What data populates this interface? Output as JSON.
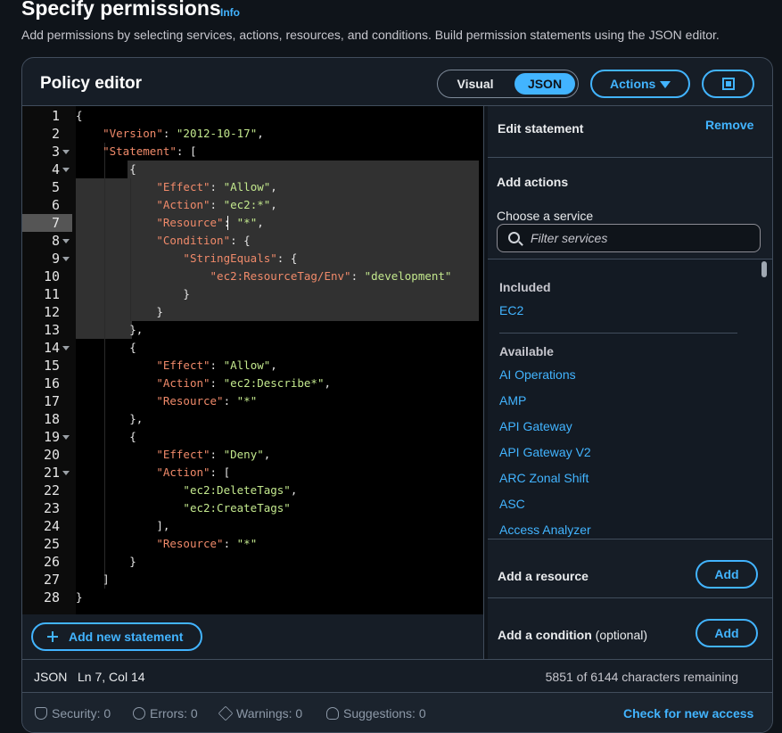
{
  "header": {
    "title": "Specify permissions",
    "info": "Info",
    "subtitle": "Add permissions by selecting services, actions, resources, and conditions. Build permission statements using the JSON editor."
  },
  "editor_panel": {
    "title": "Policy editor",
    "mode_visual": "Visual",
    "mode_json": "JSON",
    "actions_label": "Actions",
    "add_statement_label": "Add new statement"
  },
  "code": {
    "line_numbers": [
      "1",
      "2",
      "3",
      "4",
      "5",
      "6",
      "7",
      "8",
      "9",
      "10",
      "11",
      "12",
      "13",
      "14",
      "15",
      "16",
      "17",
      "18",
      "19",
      "20",
      "21",
      "22",
      "23",
      "24",
      "25",
      "26",
      "27",
      "28"
    ],
    "cursor_line": 7,
    "tokens": {
      "l1": "{",
      "l2_key": "\"Version\"",
      "l2_val": "\"2012-10-17\"",
      "l3_key": "\"Statement\"",
      "l3_rest": ": [",
      "l4": "{",
      "l5_key": "\"Effect\"",
      "l5_val": "\"Allow\"",
      "l6_key": "\"Action\"",
      "l6_val": "\"ec2:*\"",
      "l7_key": "\"Resource\"",
      "l7_val": "\"*\"",
      "l8_key": "\"Condition\"",
      "l8_rest": ": {",
      "l9_key": "\"StringEquals\"",
      "l9_rest": ": {",
      "l10_key": "\"ec2:ResourceTag/Env\"",
      "l10_val": "\"development\"",
      "l11": "}",
      "l12": "}",
      "l13": "},",
      "l14": "{",
      "l15_key": "\"Effect\"",
      "l15_val": "\"Allow\"",
      "l16_key": "\"Action\"",
      "l16_val": "\"ec2:Describe*\"",
      "l17_key": "\"Resource\"",
      "l17_val": "\"*\"",
      "l18": "},",
      "l19": "{",
      "l20_key": "\"Effect\"",
      "l20_val": "\"Deny\"",
      "l21_key": "\"Action\"",
      "l21_rest": ": [",
      "l22_val": "\"ec2:DeleteTags\"",
      "l23_val": "\"ec2:CreateTags\"",
      "l24": "],",
      "l25_key": "\"Resource\"",
      "l25_val": "\"*\"",
      "l26": "}",
      "l27": "]",
      "l28": "}"
    }
  },
  "statement_panel": {
    "title": "Edit statement",
    "remove": "Remove",
    "add_actions": "Add actions",
    "choose_service": "Choose a service",
    "filter_placeholder": "Filter services",
    "included_label": "Included",
    "included": [
      "EC2"
    ],
    "available_label": "Available",
    "available": [
      "AI Operations",
      "AMP",
      "API Gateway",
      "API Gateway V2",
      "ARC Zonal Shift",
      "ASC",
      "Access Analyzer"
    ],
    "add_resource": "Add a resource",
    "add_condition": "Add a condition",
    "optional": "(optional)",
    "add_button": "Add"
  },
  "status": {
    "mode": "JSON",
    "position": "Ln 7, Col 14",
    "remaining": "5851 of 6144 characters remaining"
  },
  "footer": {
    "security": "Security: 0",
    "errors": "Errors: 0",
    "warnings": "Warnings: 0",
    "suggestions": "Suggestions: 0",
    "check_access": "Check for new access"
  },
  "colors": {
    "accent": "#42b4ff",
    "background": "#0f141a",
    "json_key": "#f08a6a",
    "json_string": "#c3e88d"
  }
}
